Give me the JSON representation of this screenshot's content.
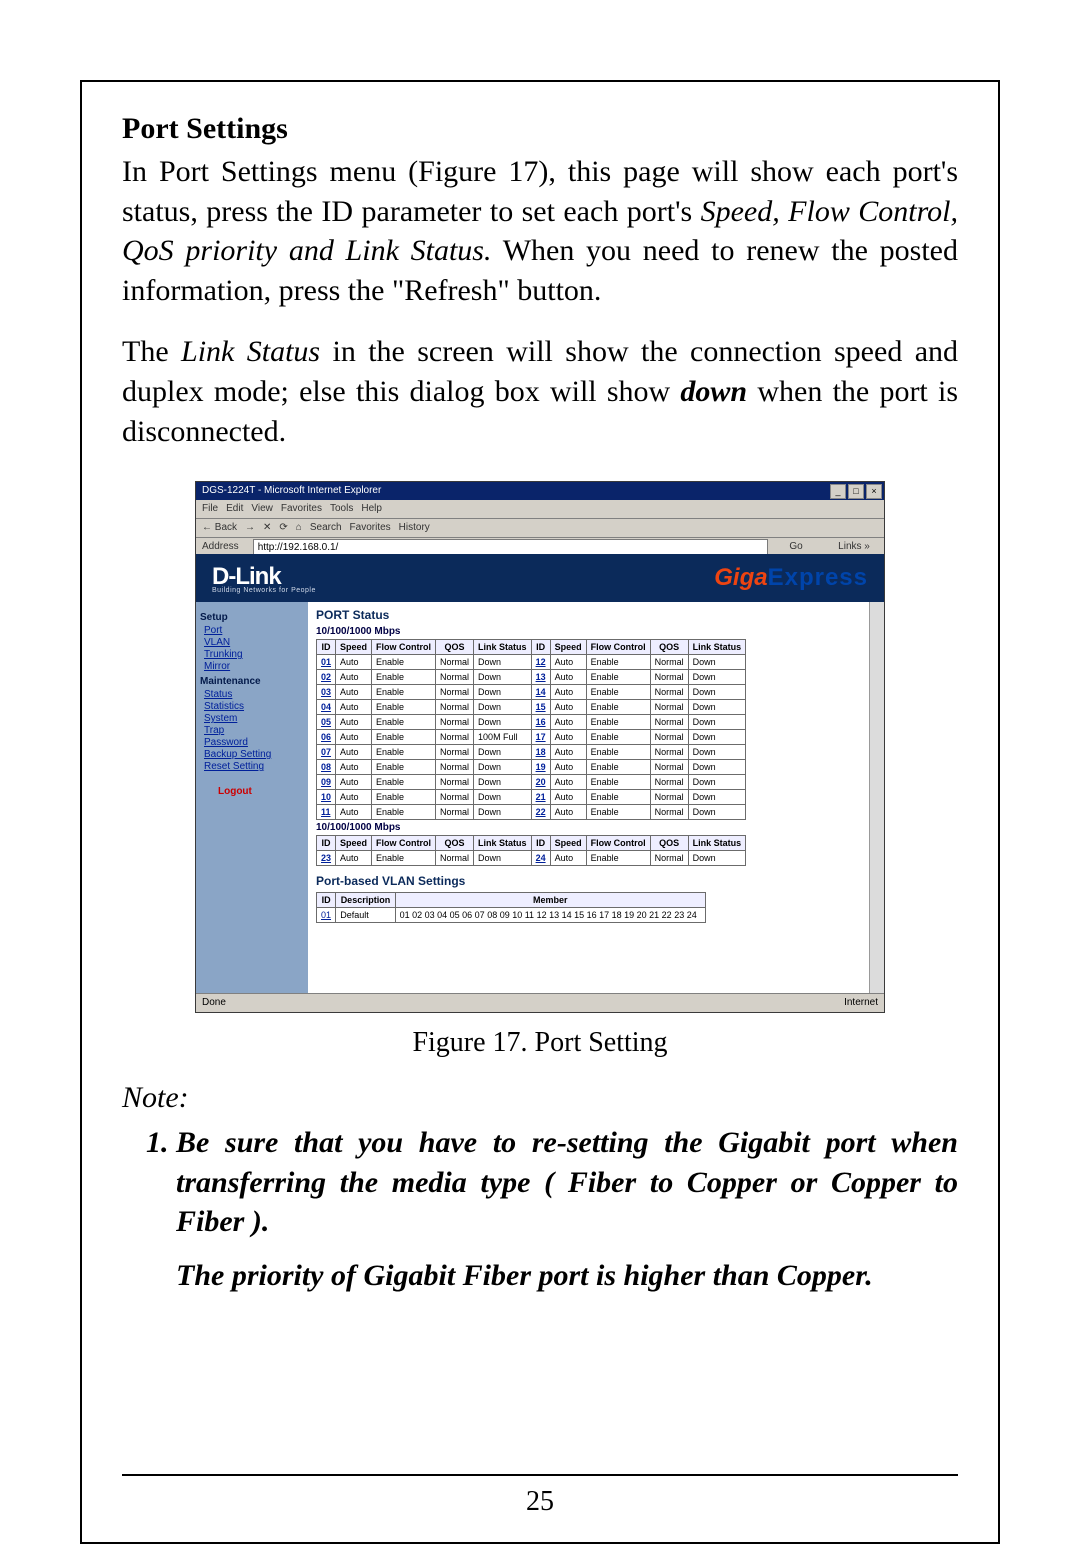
{
  "heading": "Port Settings",
  "paragraph1_a": "In Port Settings menu (Figure 17), this page will show each port's status, press the ID parameter to set each port's ",
  "paragraph1_b": "Speed, Flow Control, QoS priority and Link Status.",
  "paragraph1_c": " When you need to renew the posted information, press the \"Refresh\" button.",
  "paragraph2_a": "The ",
  "paragraph2_b": "Link Status",
  "paragraph2_c": " in the screen will show the connection speed and duplex mode; else this dialog box will show ",
  "paragraph2_d": "down",
  "paragraph2_e": " when the port is disconnected.",
  "fig_caption": "Figure 17. Port Setting",
  "note_label": "Note:",
  "note1": "Be sure that you have to re-setting the Gigabit port when transferring the media type ( Fiber to Copper or Copper to Fiber ).",
  "note_sub": "The priority of Gigabit Fiber port is higher than Copper.",
  "page_number": "25",
  "ie": {
    "title": "DGS-1224T - Microsoft Internet Explorer",
    "menu": [
      "File",
      "Edit",
      "View",
      "Favorites",
      "Tools",
      "Help"
    ],
    "toolbar": [
      "← Back",
      "→",
      "✕",
      "⟳",
      "⌂",
      "Search",
      "Favorites",
      "History"
    ],
    "addr_label": "Address",
    "addr_value": "http://192.168.0.1/",
    "go": "Go",
    "links": "Links »",
    "status_left": "Done",
    "status_right": "Internet"
  },
  "app": {
    "brand": "D-Link",
    "brand_sub": "Building Networks for People",
    "giga1": "Giga",
    "giga2": "Express",
    "sidebar": {
      "cat1": "Setup",
      "items1": [
        "Port",
        "VLAN",
        "Trunking",
        "Mirror"
      ],
      "cat2": "Maintenance",
      "items2": [
        "Status",
        "Statistics",
        "System",
        "Trap",
        "Password",
        "Backup Setting",
        "Reset Setting"
      ],
      "logout": "Logout"
    },
    "port_status_title": "PORT Status",
    "group1": "10/100/1000 Mbps",
    "group2": "10/100/1000 Mbps",
    "vlan_title": "Port-based VLAN Settings",
    "table_headers": [
      "ID",
      "Speed",
      "Flow Control",
      "QOS",
      "Link Status",
      "ID",
      "Speed",
      "Flow Control",
      "QOS",
      "Link Status"
    ],
    "rows1": [
      [
        "01",
        "Auto",
        "Enable",
        "Normal",
        "Down",
        "12",
        "Auto",
        "Enable",
        "Normal",
        "Down"
      ],
      [
        "02",
        "Auto",
        "Enable",
        "Normal",
        "Down",
        "13",
        "Auto",
        "Enable",
        "Normal",
        "Down"
      ],
      [
        "03",
        "Auto",
        "Enable",
        "Normal",
        "Down",
        "14",
        "Auto",
        "Enable",
        "Normal",
        "Down"
      ],
      [
        "04",
        "Auto",
        "Enable",
        "Normal",
        "Down",
        "15",
        "Auto",
        "Enable",
        "Normal",
        "Down"
      ],
      [
        "05",
        "Auto",
        "Enable",
        "Normal",
        "Down",
        "16",
        "Auto",
        "Enable",
        "Normal",
        "Down"
      ],
      [
        "06",
        "Auto",
        "Enable",
        "Normal",
        "100M Full",
        "17",
        "Auto",
        "Enable",
        "Normal",
        "Down"
      ],
      [
        "07",
        "Auto",
        "Enable",
        "Normal",
        "Down",
        "18",
        "Auto",
        "Enable",
        "Normal",
        "Down"
      ],
      [
        "08",
        "Auto",
        "Enable",
        "Normal",
        "Down",
        "19",
        "Auto",
        "Enable",
        "Normal",
        "Down"
      ],
      [
        "09",
        "Auto",
        "Enable",
        "Normal",
        "Down",
        "20",
        "Auto",
        "Enable",
        "Normal",
        "Down"
      ],
      [
        "10",
        "Auto",
        "Enable",
        "Normal",
        "Down",
        "21",
        "Auto",
        "Enable",
        "Normal",
        "Down"
      ],
      [
        "11",
        "Auto",
        "Enable",
        "Normal",
        "Down",
        "22",
        "Auto",
        "Enable",
        "Normal",
        "Down"
      ]
    ],
    "rows2": [
      [
        "23",
        "Auto",
        "Enable",
        "Normal",
        "Down",
        "24",
        "Auto",
        "Enable",
        "Normal",
        "Down"
      ]
    ],
    "vlan_headers": [
      "ID",
      "Description",
      "Member"
    ],
    "vlan_row": [
      "01",
      "Default",
      "01 02 03 04 05 06 07 08 09 10 11 12 13 14 15 16 17 18 19 20 21 22 23 24"
    ]
  }
}
